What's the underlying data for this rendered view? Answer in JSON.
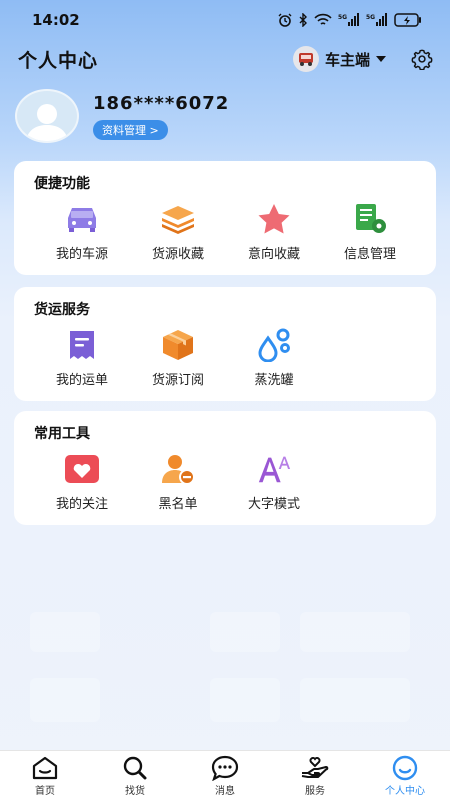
{
  "status_bar": {
    "time": "14:02"
  },
  "header": {
    "title": "个人中心",
    "role": "车主端"
  },
  "profile": {
    "phone": "186****6072",
    "manage_label": "资料管理 >"
  },
  "quick_functions": {
    "title": "便捷功能",
    "items": [
      {
        "label": "我的车源",
        "icon": "car-icon"
      },
      {
        "label": "货源收藏",
        "icon": "layers-icon"
      },
      {
        "label": "意向收藏",
        "icon": "star-icon"
      },
      {
        "label": "信息管理",
        "icon": "document-gear-icon"
      }
    ]
  },
  "freight_services": {
    "title": "货运服务",
    "items": [
      {
        "label": "我的运单",
        "icon": "receipt-icon"
      },
      {
        "label": "货源订阅",
        "icon": "box-icon"
      },
      {
        "label": "蒸洗罐",
        "icon": "water-drops-icon"
      }
    ]
  },
  "tools": {
    "title": "常用工具",
    "items": [
      {
        "label": "我的关注",
        "icon": "heart-icon"
      },
      {
        "label": "黑名单",
        "icon": "user-block-icon"
      },
      {
        "label": "大字模式",
        "icon": "font-size-icon"
      }
    ]
  },
  "bottom_nav": {
    "items": [
      {
        "label": "首页",
        "icon": "home-icon"
      },
      {
        "label": "找货",
        "icon": "search-icon"
      },
      {
        "label": "消息",
        "icon": "message-icon"
      },
      {
        "label": "服务",
        "icon": "service-hand-icon"
      },
      {
        "label": "个人中心",
        "icon": "profile-face-icon",
        "active": true
      }
    ]
  },
  "colors": {
    "accent": "#2f8ef0",
    "orange": "#f08a2c",
    "purple": "#7b5fd6",
    "red": "#ec4c56",
    "green": "#3aa84a"
  }
}
